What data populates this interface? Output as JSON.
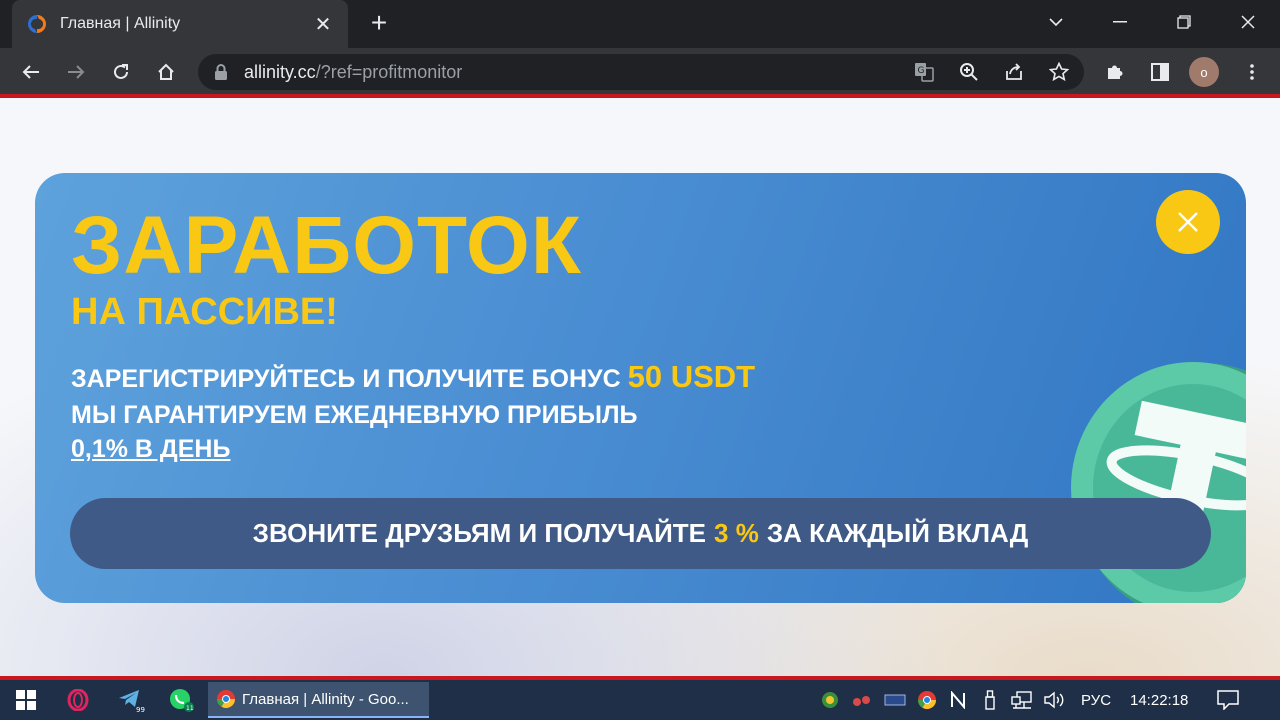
{
  "browser": {
    "tab_title": "Главная | Allinity",
    "url_host": "allinity.cc",
    "url_path": "/?ref=profitmonitor",
    "profile_initial": "о"
  },
  "banner": {
    "title": "ЗАРАБОТОК",
    "subtitle": "НА ПАССИВЕ!",
    "line1_text": "ЗАРЕГИСТРИРУЙТЕСЬ И ПОЛУЧИТЕ БОНУС",
    "line1_highlight": "50 USDT",
    "line2_text": "МЫ ГАРАНТИРУЕМ ЕЖЕДНЕВНУЮ ПРИБЫЛЬ",
    "line3_link": "0,1% В ДЕНЬ",
    "cta_before": "ЗВОНИТЕ ДРУЗЬЯМ И ПОЛУЧАЙТЕ",
    "cta_highlight": "3 %",
    "cta_after": "ЗА КАЖДЫЙ ВКЛАД",
    "accent_color": "#f9c815",
    "background_color": "#4c8fd3"
  },
  "taskbar": {
    "active_app_label": "Главная | Allinity - Goo...",
    "telegram_badge": "99",
    "whatsapp_badge": "11",
    "language": "РУС",
    "clock": "14:22:18"
  }
}
